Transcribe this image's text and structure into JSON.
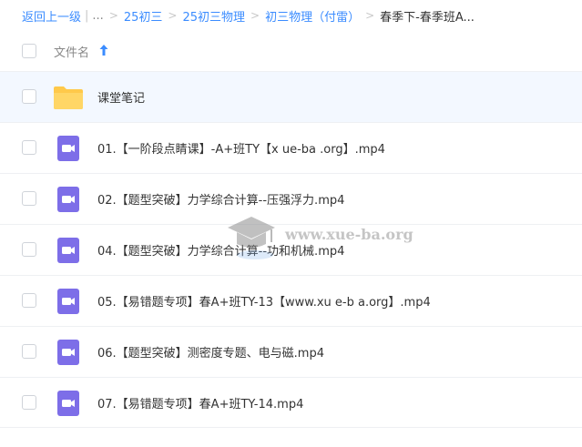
{
  "breadcrumb": {
    "back": "返回上一级",
    "ellipsis": "...",
    "items": [
      "25初三",
      "25初三物理",
      "初三物理（付雷）"
    ],
    "current": "春季下-春季班A..."
  },
  "header": {
    "column_label": "文件名"
  },
  "files": [
    {
      "name": "课堂笔记",
      "kind": "folder"
    },
    {
      "name": "01.【一阶段点睛课】-A+班TY【x ue-ba .org】.mp4",
      "kind": "video"
    },
    {
      "name": "02.【题型突破】力学综合计算--压强浮力.mp4",
      "kind": "video"
    },
    {
      "name": "04.【题型突破】力学综合计算--功和机械.mp4",
      "kind": "video"
    },
    {
      "name": "05.【易错题专项】春A+班TY-13【www.xu e-b a.org】.mp4",
      "kind": "video"
    },
    {
      "name": "06.【题型突破】测密度专题、电与磁.mp4",
      "kind": "video"
    },
    {
      "name": "07.【易错题专项】春A+班TY-14.mp4",
      "kind": "video"
    }
  ],
  "watermark": {
    "text": "www.xue-ba.org"
  },
  "colors": {
    "link": "#3b8cff",
    "folder": "#ffc94a",
    "video": "#7d6ee8",
    "folder_row_bg": "#f3f8ff"
  },
  "icons": {
    "folder": "folder-icon",
    "video": "video-file-icon",
    "sort": "sort-arrow-up-icon"
  }
}
